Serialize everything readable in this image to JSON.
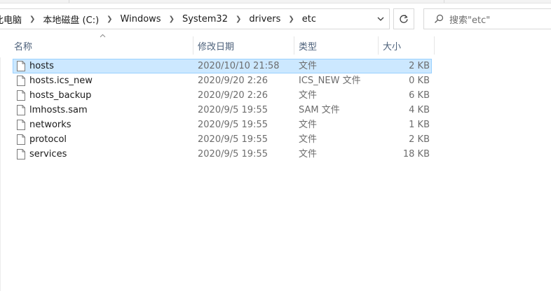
{
  "address": {
    "crumbs": [
      "此电脑",
      "本地磁盘 (C:)",
      "Windows",
      "System32",
      "drivers",
      "etc"
    ]
  },
  "search": {
    "placeholder": "搜索\"etc\""
  },
  "columns": {
    "name": "名称",
    "date": "修改日期",
    "type": "类型",
    "size": "大小"
  },
  "files": [
    {
      "name": "hosts",
      "date": "2020/10/10 21:58",
      "type": "文件",
      "size": "2 KB",
      "selected": true
    },
    {
      "name": "hosts.ics_new",
      "date": "2020/9/20 2:26",
      "type": "ICS_NEW 文件",
      "size": "0 KB"
    },
    {
      "name": "hosts_backup",
      "date": "2020/9/20 2:26",
      "type": "文件",
      "size": "6 KB"
    },
    {
      "name": "lmhosts.sam",
      "date": "2020/9/5 19:55",
      "type": "SAM 文件",
      "size": "4 KB"
    },
    {
      "name": "networks",
      "date": "2020/9/5 19:55",
      "type": "文件",
      "size": "1 KB"
    },
    {
      "name": "protocol",
      "date": "2020/9/5 19:55",
      "type": "文件",
      "size": "2 KB"
    },
    {
      "name": "services",
      "date": "2020/9/5 19:55",
      "type": "文件",
      "size": "18 KB"
    }
  ],
  "icons": {
    "file": "file-icon",
    "chevron": "chevron-right-icon",
    "dropdown": "chevron-down-icon",
    "refresh": "refresh-icon",
    "search": "search-icon",
    "sort": "sort-up-icon"
  },
  "colors": {
    "selection_bg": "#cce8ff",
    "selection_border": "#99d1ff",
    "header_text": "#4c607a"
  }
}
